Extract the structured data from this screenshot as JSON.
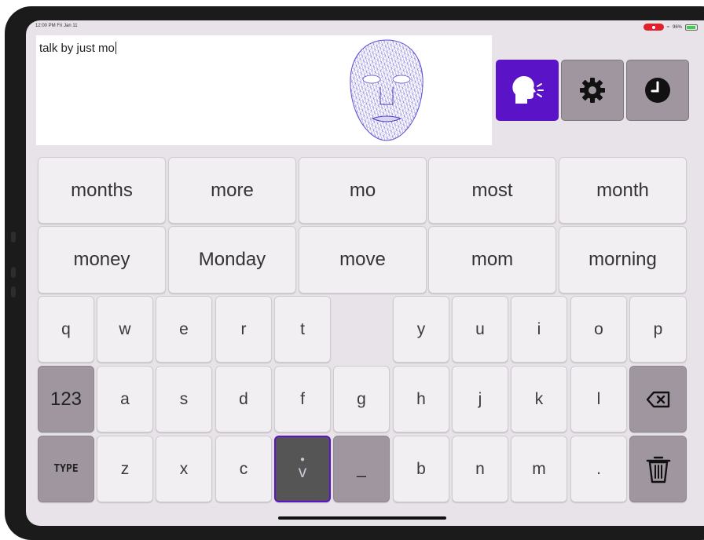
{
  "status_bar": {
    "time": "12:00 PM  Fri Jan 11",
    "battery": "96%"
  },
  "input": {
    "text": "talk by just mo"
  },
  "toolbar": {
    "speak_icon": "speaking-head-icon",
    "settings_icon": "gear-icon",
    "history_icon": "clock-icon",
    "accent_color": "#5a13c7",
    "button_color": "#9f969f"
  },
  "suggestions": {
    "row1": [
      "months",
      "more",
      "mo",
      "most",
      "month"
    ],
    "row2": [
      "money",
      "Monday",
      "move",
      "mom",
      "morning"
    ]
  },
  "keyboard": {
    "row1": [
      "q",
      "w",
      "e",
      "r",
      "t",
      "y",
      "u",
      "i",
      "o",
      "p"
    ],
    "row2": [
      "a",
      "s",
      "d",
      "f",
      "g",
      "h",
      "j",
      "k",
      "l"
    ],
    "row3": [
      "z",
      "x",
      "c",
      "v",
      "_",
      "b",
      "n",
      "m",
      "."
    ],
    "numbers_label": "123",
    "type_label": "TYPE",
    "backspace_icon": "backspace-icon",
    "trash_icon": "trash-icon"
  }
}
